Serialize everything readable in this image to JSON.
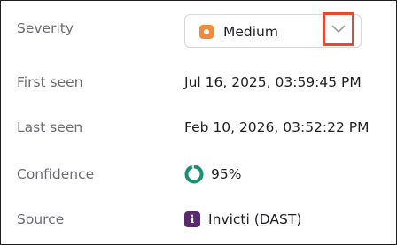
{
  "fields": {
    "severity": {
      "label": "Severity",
      "value": "Medium",
      "color": "#f08a3c"
    },
    "first_seen": {
      "label": "First seen",
      "value": "Jul 16, 2025, 03:59:45 PM"
    },
    "last_seen": {
      "label": "Last seen",
      "value": "Feb 10, 2026, 03:52:22 PM"
    },
    "confidence": {
      "label": "Confidence",
      "value": "95%",
      "fraction": 0.95,
      "color": "#1a8f78"
    },
    "source": {
      "label": "Source",
      "value": "Invicti (DAST)",
      "badge_letter": "i",
      "badge_color": "#5a2a6e"
    }
  },
  "icons": {
    "severity": "medium-severity-icon",
    "dropdown": "chevron-down-icon",
    "confidence": "confidence-ring-icon",
    "source": "invicti-logo-icon"
  },
  "colors": {
    "highlight": "#e8482b"
  }
}
